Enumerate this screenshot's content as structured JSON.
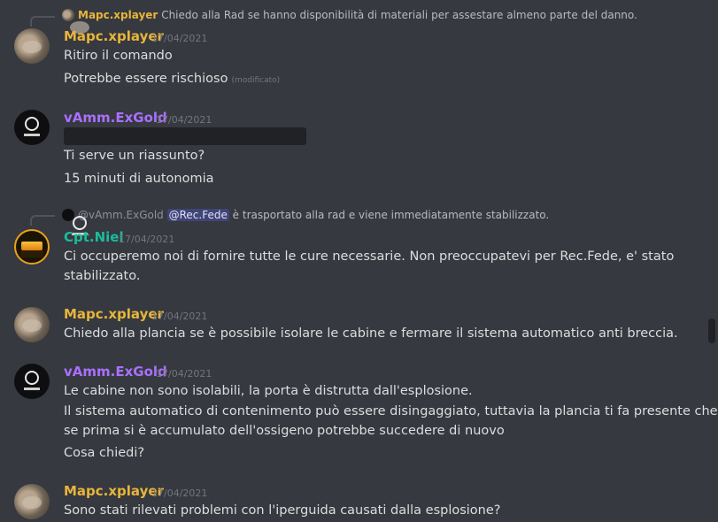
{
  "users": {
    "mapc": {
      "name": "Mapc.xplayer",
      "color": "#e8b53a",
      "avatar": "cat-photo-avatar"
    },
    "vamm": {
      "name": "vAmm.ExGold",
      "color": "#a970ff",
      "avatar": "astronaut-helmet-avatar"
    },
    "cpt": {
      "name": "Cpt.Niel",
      "color": "#1abc9c",
      "avatar": "sunset-city-avatar"
    }
  },
  "messages": [
    {
      "reply": {
        "author": "Mapc.xplayer",
        "text": "Chiedo alla Rad se hanno disponibilità di materiali per assestare almeno parte del danno."
      },
      "author": "Mapc.xplayer",
      "timestamp": "17/04/2021",
      "lines": [
        "Ritiro il comando",
        "Potrebbe essere rischioso"
      ],
      "edited_label": "(modificato)"
    },
    {
      "author": "vAmm.ExGold",
      "timestamp": "17/04/2021",
      "lines": [
        "Ti serve un riassunto?",
        "15 minuti di autonomia"
      ]
    },
    {
      "reply": {
        "author": "@vAmm.ExGold",
        "mention": "@Rec.Fede",
        "text": "è trasportato alla rad e viene immediatamente stabilizzato."
      },
      "author": "Cpt.Niel",
      "timestamp": "17/04/2021",
      "lines": [
        "Ci occuperemo noi di fornire tutte le cure necessarie. Non preoccupatevi per Rec.Fede, e' stato",
        "stabilizzato."
      ]
    },
    {
      "author": "Mapc.xplayer",
      "timestamp": "17/04/2021",
      "lines": [
        "Chiedo alla plancia se è possibile isolare le cabine e fermare il sistema automatico anti breccia."
      ]
    },
    {
      "author": "vAmm.ExGold",
      "timestamp": "17/04/2021",
      "lines": [
        "Le cabine non sono isolabili, la porta è distrutta dall'esplosione.",
        "Il sistema automatico di contenimento può essere disingaggiato, tuttavia la plancia ti fa presente che",
        "se prima si è accumulato dell'ossigeno potrebbe succedere di nuovo",
        "Cosa chiedi?"
      ]
    },
    {
      "author": "Mapc.xplayer",
      "timestamp": "17/04/2021",
      "lines": [
        "Sono stati rilevati problemi con l'iperguida causati dalla esplosione?"
      ]
    }
  ]
}
